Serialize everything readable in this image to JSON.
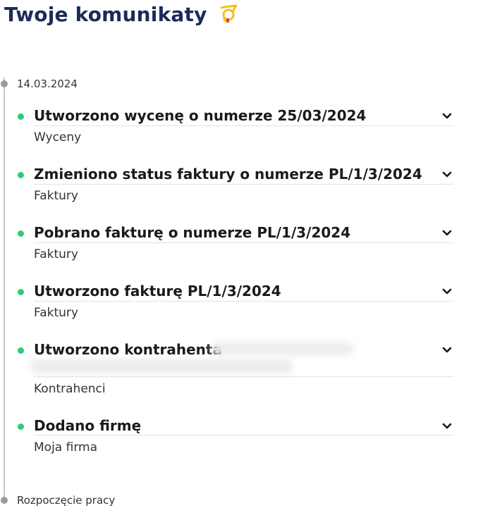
{
  "header": {
    "title": "Twoje komunikaty",
    "icon": "post-horn-icon"
  },
  "timeline": {
    "date_label": "14.03.2024",
    "end_label": "Rozpoczęcie pracy"
  },
  "messages": [
    {
      "title": "Utworzono wycenę o numerze 25/03/2024",
      "category": "Wyceny"
    },
    {
      "title": "Zmieniono status faktury o numerze PL/1/3/2024",
      "category": "Faktury"
    },
    {
      "title": "Pobrano fakturę o numerze PL/1/3/2024",
      "category": "Faktury"
    },
    {
      "title": "Utworzono fakturę PL/1/3/2024",
      "category": "Faktury"
    },
    {
      "title": "Utworzono kontrahenta",
      "category": "Kontrahenci"
    },
    {
      "title": "Dodano firmę",
      "category": "Moja firma"
    }
  ],
  "colors": {
    "title": "#1c2b5a",
    "dot_active": "#2ecc71",
    "timeline_node": "#9a9a9a"
  }
}
